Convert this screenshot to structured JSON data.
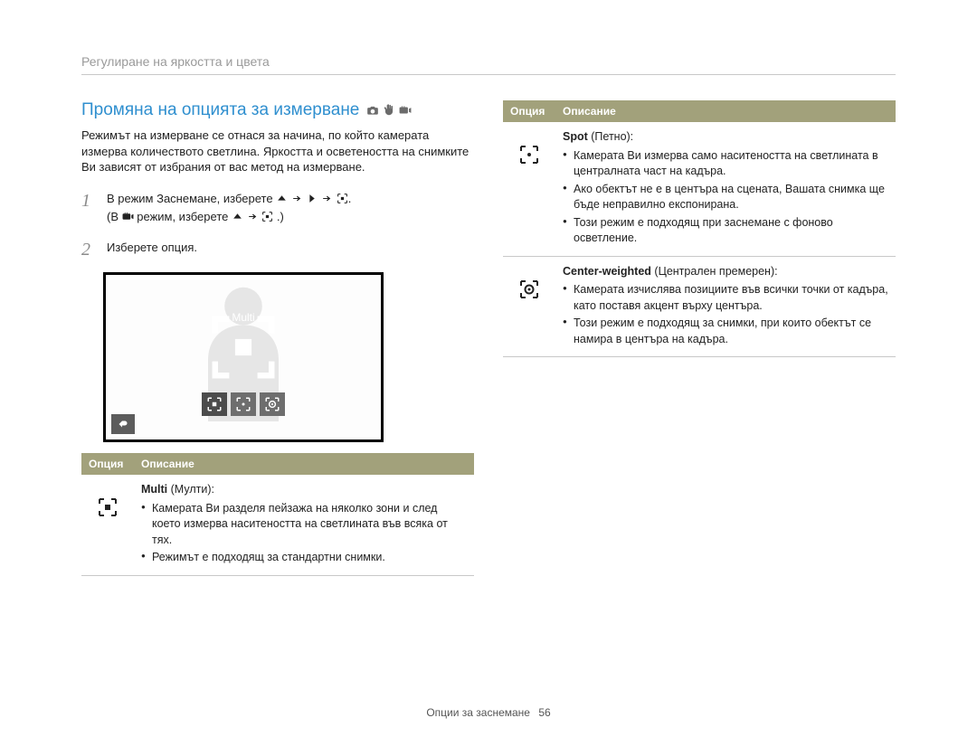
{
  "header": {
    "breadcrumb": "Регулиране на яркостта и цвета"
  },
  "section": {
    "title": "Промяна на опцията за измерване",
    "intro": "Режимът на измерване се отнася за начина, по който камерата измерва количеството светлина. Яркостта и осветеността на снимките Ви зависят от избрания от вас метод на измерване."
  },
  "steps": {
    "s1": {
      "num": "1",
      "part1": "В режим Заснемане, изберете ",
      "part2": "(В ",
      "part3": " режим, изберете ",
      "part4": ".)"
    },
    "s2": {
      "num": "2",
      "text": "Изберете опция."
    }
  },
  "screenshot": {
    "label": "Multi"
  },
  "table_left": {
    "hdr_option": "Опция",
    "hdr_desc": "Описание",
    "row0": {
      "title_bold": "Multi",
      "title_rest": " (Мулти):",
      "b0": "Камерата Ви разделя пейзажа на няколко зони и след което измерва наситеността на светлината във всяка от тях.",
      "b1": "Режимът е подходящ за стандартни снимки."
    }
  },
  "table_right": {
    "hdr_option": "Опция",
    "hdr_desc": "Описание",
    "row0": {
      "title_bold": "Spot",
      "title_rest": " (Петно):",
      "b0": "Камерата Ви измерва само наситеността на светлината в централната част на кадъра.",
      "b1": "Ако обектът не е в центъра на сцената, Вашата снимка ще бъде неправилно експонирана.",
      "b2": "Този режим е подходящ при заснемане с фоново осветление."
    },
    "row1": {
      "title_bold": "Center-weighted",
      "title_rest": " (Централен премерен):",
      "b0": "Камерата изчислява позициите във всички точки от кадъра, като поставя акцент върху центъра.",
      "b1": "Този режим е подходящ за снимки, при които обектът се намира в центъра на кадъра."
    }
  },
  "footer": {
    "text": "Опции за заснемане",
    "page": "56"
  }
}
